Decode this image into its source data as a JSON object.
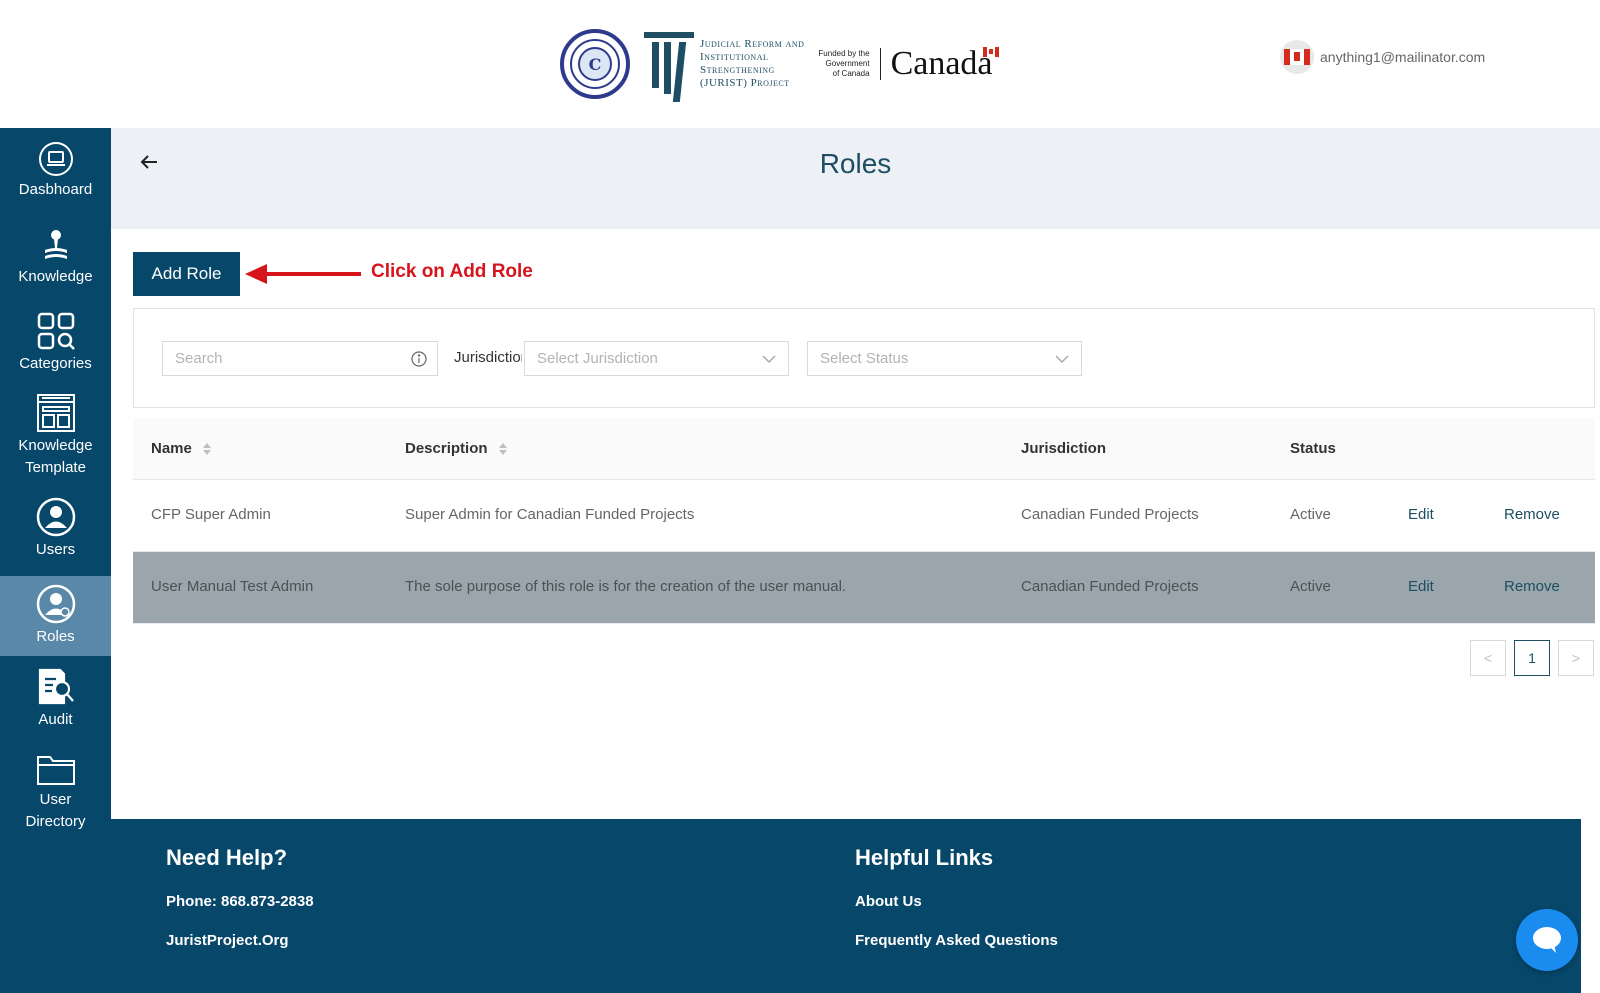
{
  "header": {
    "jurist_logo_text": [
      "Judicial Reform and",
      "Institutional",
      "Strengthening",
      "(JURIST) Project"
    ],
    "funded_text": [
      "Funded by the",
      "Government",
      "of Canada"
    ],
    "canada_wordmark": "Canada",
    "user_email": "anything1@mailinator.com"
  },
  "sidebar": {
    "items": [
      {
        "label": "Dasbhoard",
        "icon": "laptop-icon"
      },
      {
        "label": "Knowledge",
        "icon": "knowledge-icon"
      },
      {
        "label": "Categories",
        "icon": "categories-icon"
      },
      {
        "label": "Knowledge Template",
        "icon": "template-icon"
      },
      {
        "label": "Users",
        "icon": "user-icon"
      },
      {
        "label": "Roles",
        "icon": "roles-icon",
        "active": true
      },
      {
        "label": "Audit",
        "icon": "audit-icon"
      },
      {
        "label": "User Directory",
        "icon": "folder-icon"
      }
    ]
  },
  "page": {
    "title": "Roles"
  },
  "toolbar": {
    "add_role_label": "Add Role",
    "callout_text": "Click on Add Role"
  },
  "filters": {
    "search_placeholder": "Search",
    "jurisdiction_label": "Jurisdiction",
    "jurisdiction_placeholder": "Select Jurisdiction",
    "status_placeholder": "Select Status"
  },
  "table": {
    "columns": [
      "Name",
      "Description",
      "Jurisdiction",
      "Status"
    ],
    "rows": [
      {
        "name": "CFP Super Admin",
        "description": "Super Admin for Canadian Funded Projects",
        "jurisdiction": "Canadian Funded Projects",
        "status": "Active",
        "edit": "Edit",
        "remove": "Remove"
      },
      {
        "name": "User Manual Test Admin",
        "description": "The sole purpose of this role is for the creation of the user manual.",
        "jurisdiction": "Canadian Funded Projects",
        "status": "Active",
        "edit": "Edit",
        "remove": "Remove",
        "highlighted": true
      }
    ]
  },
  "pagination": {
    "prev": "<",
    "current": "1",
    "next": ">"
  },
  "footer": {
    "help_heading": "Need Help?",
    "phone": "Phone: 868.873-2838",
    "site": "JuristProject.Org",
    "links_heading": "Helpful Links",
    "about": "About Us",
    "faq": "Frequently Asked Questions"
  },
  "colors": {
    "brand": "#07476a",
    "active_nav": "#5a88a8",
    "callout": "#d8141b",
    "chat": "#1a8cf0"
  }
}
